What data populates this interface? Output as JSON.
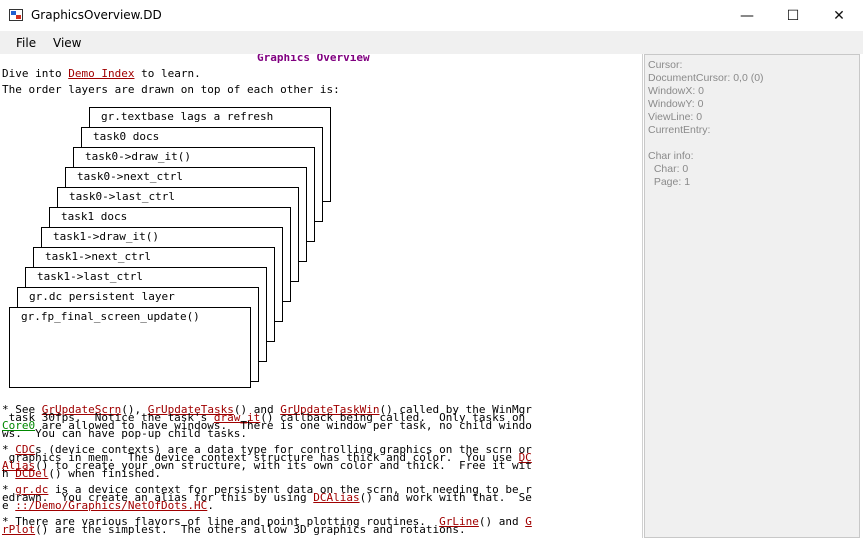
{
  "window": {
    "title": "GraphicsOverview.DD",
    "minimize_glyph": "—",
    "maximize_glyph": "☐",
    "close_glyph": "✕"
  },
  "menu": {
    "file": "File",
    "view": "View"
  },
  "doc": {
    "heading": "Graphics Overview",
    "intro_1a": "Dive into ",
    "intro_link": "Demo Index",
    "intro_1b": " to learn.",
    "intro_2": "The order layers are drawn on top of each other is:",
    "layers": [
      "gr.textbase lags a refresh",
      "task0 docs",
      "task0->draw_it()",
      "task0->next_ctrl",
      "task0->last_ctrl",
      "task1 docs",
      "task1->draw_it()",
      "task1->next_ctrl",
      "task1->last_ctrl",
      "gr.dc persistent layer",
      "gr.fp_final_screen_update()"
    ],
    "p1": {
      "a": "* See ",
      "l1": "GrUpdateScrn",
      "b": "(), ",
      "l2": "GrUpdateTasks",
      "c": "() and ",
      "l3": "GrUpdateTaskWin",
      "d": "() called by the WinMgr",
      "line2a": " task 30fps.  Notice the task's ",
      "l4": "draw_it",
      "line2b": "() callback being called.  Only tasks on",
      "g1": "Core0",
      "line3": " are allowed to have windows.  There is one window per task, no child windo",
      "line4": "ws.  You can have pop-up child tasks."
    },
    "p2": {
      "a": "* ",
      "l1": "CDC",
      "b": "s (device contexts) are a data type for controlling graphics on the scrn or",
      "line2a": " graphics in mem.  The device context structure has thick and color.  You use ",
      "l2": "DC",
      "l3": "Alias",
      "line3": "() to create your own structure, with its own color and thick.  Free it wit",
      "line4a": "h ",
      "l4": "DCDel",
      "line4b": "() when finished."
    },
    "p3": {
      "a": "* ",
      "l1": "gr.dc",
      "b": " is a device context for persistent data on the scrn, not needing to be r",
      "line2a": "edrawn.  You create an alias for this by using ",
      "l2": "DCAlias",
      "line2b": "() and work with that.  Se",
      "line3a": "e ",
      "l3": "::/Demo/Graphics/NetOfDots.HC",
      "line3b": "."
    },
    "p4": {
      "a": "* There are various flavors of line and point plotting routines.  ",
      "l1": "GrLine",
      "b": "() and ",
      "l2": "G",
      "l3": "rPlot",
      "line2": "() are the simplest.  The others allow 3D graphics and rotations."
    }
  },
  "panel": {
    "cursor": "Cursor:",
    "doc_cursor": "DocumentCursor: 0,0 (0)",
    "window_x": "WindowX: 0",
    "window_y": "WindowY: 0",
    "view_line": "ViewLine: 0",
    "current_entry": "CurrentEntry:",
    "char_info": "Char info:",
    "char": "  Char: 0",
    "page": "  Page: 1"
  }
}
